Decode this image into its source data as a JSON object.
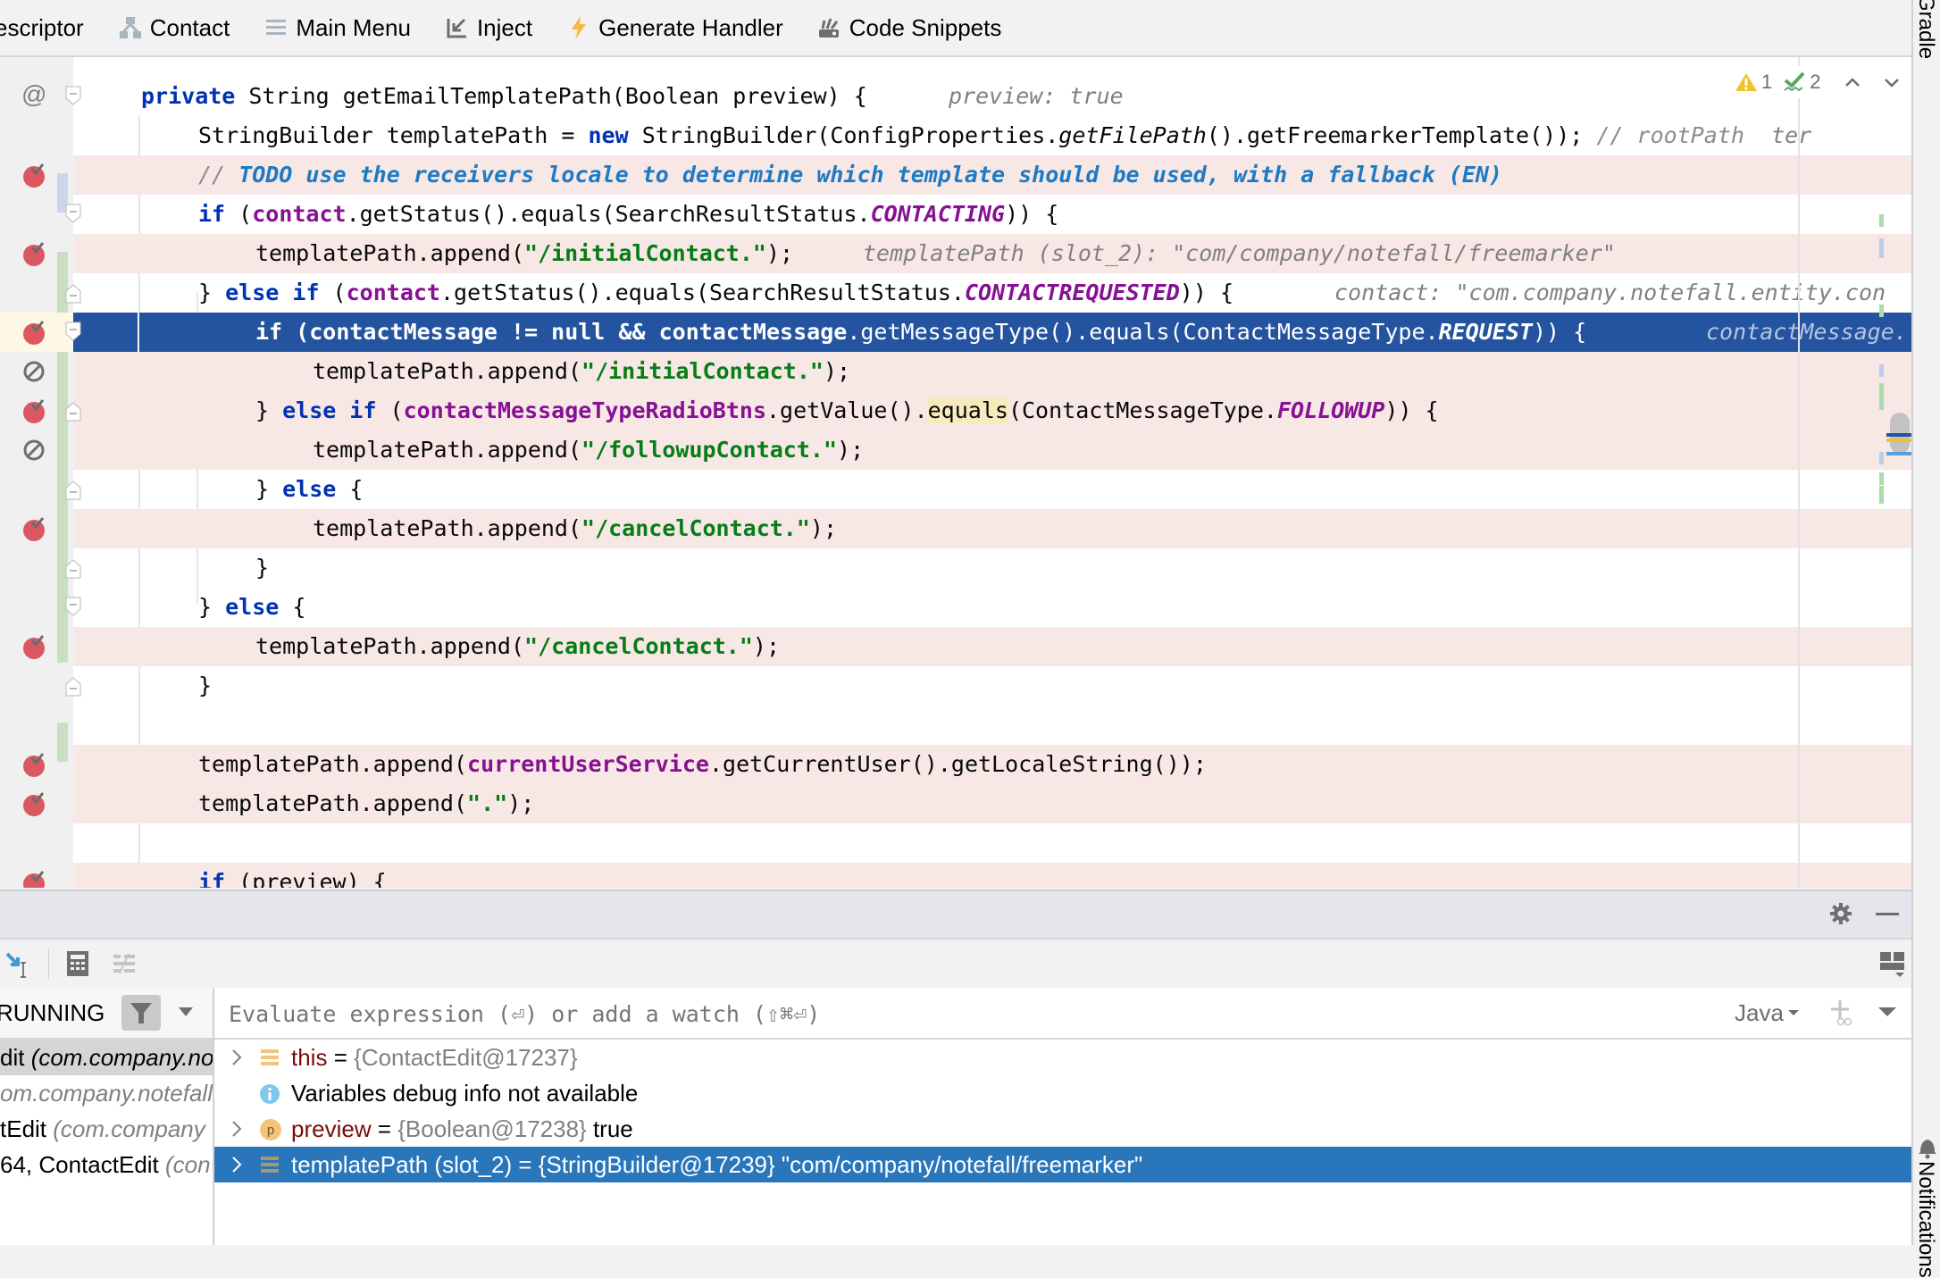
{
  "toolbar": {
    "items": [
      {
        "label": "escriptor",
        "icon": "descriptor"
      },
      {
        "label": "Contact",
        "icon": "hierarchy-icon"
      },
      {
        "label": "Main Menu",
        "icon": "menu-icon"
      },
      {
        "label": "Inject",
        "icon": "inject-icon"
      },
      {
        "label": "Generate Handler",
        "icon": "lightning-icon"
      },
      {
        "label": "Code Snippets",
        "icon": "snippets-icon"
      }
    ]
  },
  "side_panels": {
    "top": "Gradle",
    "bottom": "Notifications"
  },
  "editor": {
    "inspections": {
      "warnings": "1",
      "weak_warnings": "2"
    },
    "lines": [
      {
        "text": "private String getEmailTemplatePath(Boolean preview) {",
        "hint": "preview: true"
      },
      {
        "text": "StringBuilder templatePath = new StringBuilder(ConfigProperties.getFilePath().getFreemarkerTemplate());",
        "comment": "// rootPath",
        "hint": "ter"
      },
      {
        "text": "// TODO use the receivers locale to determine which template should be used, with a fallback (EN)"
      },
      {
        "text": "if (contact.getStatus().equals(SearchResultStatus.CONTACTING)) {"
      },
      {
        "text": "templatePath.append(\"/initialContact.\");",
        "hint": "templatePath (slot_2): \"com/company/notefall/freemarker\""
      },
      {
        "text": "} else if (contact.getStatus().equals(SearchResultStatus.CONTACTREQUESTED)) {",
        "hint": "contact: \"com.company.notefall.entity.con"
      },
      {
        "text": "if (contactMessage != null && contactMessage.getMessageType().equals(ContactMessageType.REQUEST)) {",
        "hint": "contactMessage."
      },
      {
        "text": "templatePath.append(\"/initialContact.\");"
      },
      {
        "text": "} else if (contactMessageTypeRadioBtns.getValue().equals(ContactMessageType.FOLLOWUP)) {"
      },
      {
        "text": "templatePath.append(\"/followupContact.\");"
      },
      {
        "text": "} else {"
      },
      {
        "text": "templatePath.append(\"/cancelContact.\");"
      },
      {
        "text": "}"
      },
      {
        "text": "} else {"
      },
      {
        "text": "templatePath.append(\"/cancelContact.\");"
      },
      {
        "text": "}"
      },
      {
        "text": ""
      },
      {
        "text": "templatePath.append(currentUserService.getCurrentUser().getLocaleString());"
      },
      {
        "text": "templatePath.append(\".\");"
      },
      {
        "text": ""
      },
      {
        "text": "if (preview) {"
      }
    ],
    "tokens": {
      "private": "private",
      "string": " String getEmailTemplatePath(Boolean preview) {",
      "hint0": "preview: true",
      "l1a": "StringBuilder templatePath = ",
      "new": "new",
      "l1b": " StringBuilder(ConfigProperties.",
      "getFilePath": "getFilePath",
      "l1c": "().getFreemarkerTemplate()); ",
      "l1cmt": "// rootPath",
      "l1hint": "ter",
      "l2slash": "// ",
      "l2todo": "TODO use the receivers locale to determine which template should be used, with a fallback (EN)",
      "if": "if",
      "else": "else",
      "open": " (",
      "contact": "contact",
      "l3b": ".getStatus().equals(SearchResultStatus.",
      "CONTACTING": "CONTACTING",
      "l3c": ")) {",
      "tp_append": "templatePath.append(",
      "s_initial": "\"/initialContact.\"",
      "s_followup": "\"/followupContact.\"",
      "s_cancel": "\"/cancelContact.\"",
      "s_dot": "\".\"",
      "close_semi": ");",
      "hint4": "templatePath (slot_2): \"com/company/notefall/freemarker\"",
      "brace_close": "} ",
      "CONTACTREQUESTED": "CONTACTREQUESTED",
      "hint5": "contact: \"com.company.notefall.entity.con",
      "contactMessage": "contactMessage",
      "ne": " != ",
      "null": "null",
      "and": " && ",
      "l6b": ".getMessageType().equals(ContactMessageType.",
      "REQUEST": "REQUEST",
      "hint6": "contactMessage.",
      "radio": "contactMessageTypeRadioBtns",
      "l8b": ".getValue().",
      "equals": "equals",
      "l8c": "(ContactMessageType.",
      "FOLLOWUP": "FOLLOWUP",
      "brace_open": " {",
      "rbrace": "}",
      "currentUserService": "currentUserService",
      "l17b": ".getCurrentUser().getLocaleString());",
      "l20b": " (preview) {"
    }
  },
  "debugger": {
    "status": "RUNNING",
    "eval_placeholder": "Evaluate expression (⏎) or add a watch (⇧⌘⏎)",
    "language": "Java",
    "frames": [
      {
        "method": "dit ",
        "location": "(com.company.no"
      },
      {
        "method": "",
        "location": "om.company.notefall"
      },
      {
        "method": "tEdit ",
        "location": "(com.company"
      },
      {
        "method": "64, ContactEdit ",
        "location": "(con"
      }
    ],
    "variables": [
      {
        "name": "this",
        "eq": " = ",
        "value": "{ContactEdit@17237}",
        "extra": "",
        "icon": "field-icon"
      },
      {
        "name": "",
        "eq": "",
        "value": "",
        "extra": "Variables debug info not available",
        "icon": "info-icon"
      },
      {
        "name": "preview",
        "eq": " = ",
        "value": "{Boolean@17238}",
        "extra": " true",
        "icon": "parameter-icon"
      },
      {
        "name": "templatePath (slot_2)",
        "eq": " = ",
        "value": "{StringBuilder@17239}",
        "extra": " \"com/company/notefall/freemarker\"",
        "icon": "field-icon"
      }
    ]
  }
}
